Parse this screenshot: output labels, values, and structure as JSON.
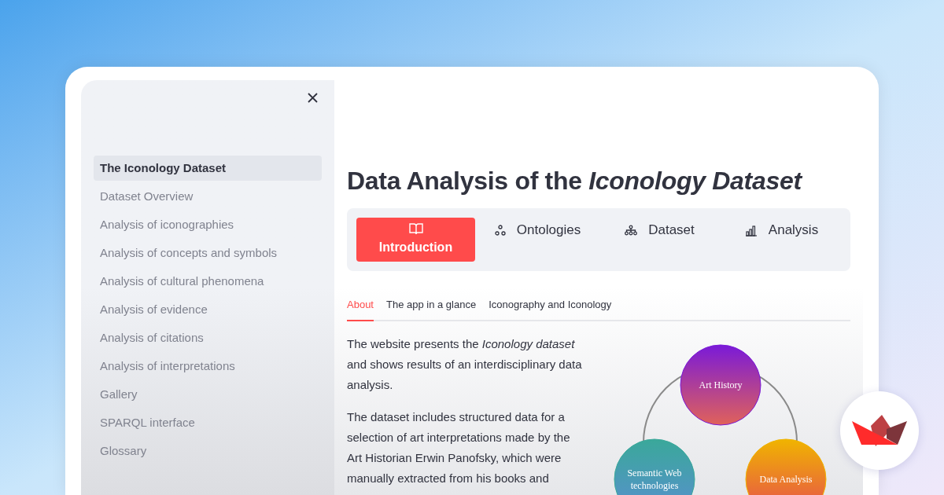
{
  "sidebar": {
    "items": [
      {
        "label": "The Iconology Dataset",
        "selected": true
      },
      {
        "label": "Dataset Overview",
        "selected": false
      },
      {
        "label": "Analysis of iconographies",
        "selected": false
      },
      {
        "label": "Analysis of concepts and symbols",
        "selected": false
      },
      {
        "label": "Analysis of cultural phenomena",
        "selected": false
      },
      {
        "label": "Analysis of evidence",
        "selected": false
      },
      {
        "label": "Analysis of citations",
        "selected": false
      },
      {
        "label": "Analysis of interpretations",
        "selected": false
      },
      {
        "label": "Gallery",
        "selected": false
      },
      {
        "label": "SPARQL interface",
        "selected": false
      },
      {
        "label": "Glossary",
        "selected": false
      }
    ]
  },
  "title": "Data Analysis of the *Iconology Dataset*",
  "tabs": [
    {
      "label": "Introduction",
      "selected": true
    },
    {
      "label": "Ontologies",
      "selected": false
    },
    {
      "label": "Dataset",
      "selected": false
    },
    {
      "label": "Analysis",
      "selected": false
    }
  ],
  "subtabs": [
    {
      "label": "About",
      "selected": true
    },
    {
      "label": "The app in a glance",
      "selected": false
    },
    {
      "label": "Iconography and Iconology",
      "selected": false
    }
  ],
  "paragraphs": [
    "The website presents the *Iconology dataset* and shows results of an interdisciplinary data analysis.",
    "The dataset includes structured data for a selection of art interpretations made by the Art Historian Erwin Panofsky, which were manually extracted from his books and"
  ],
  "diagram": {
    "nodes": [
      {
        "lines": [
          "Art History"
        ]
      },
      {
        "lines": [
          "Semantic Web",
          "technologies"
        ]
      },
      {
        "lines": [
          "Data Analysis"
        ]
      }
    ]
  }
}
